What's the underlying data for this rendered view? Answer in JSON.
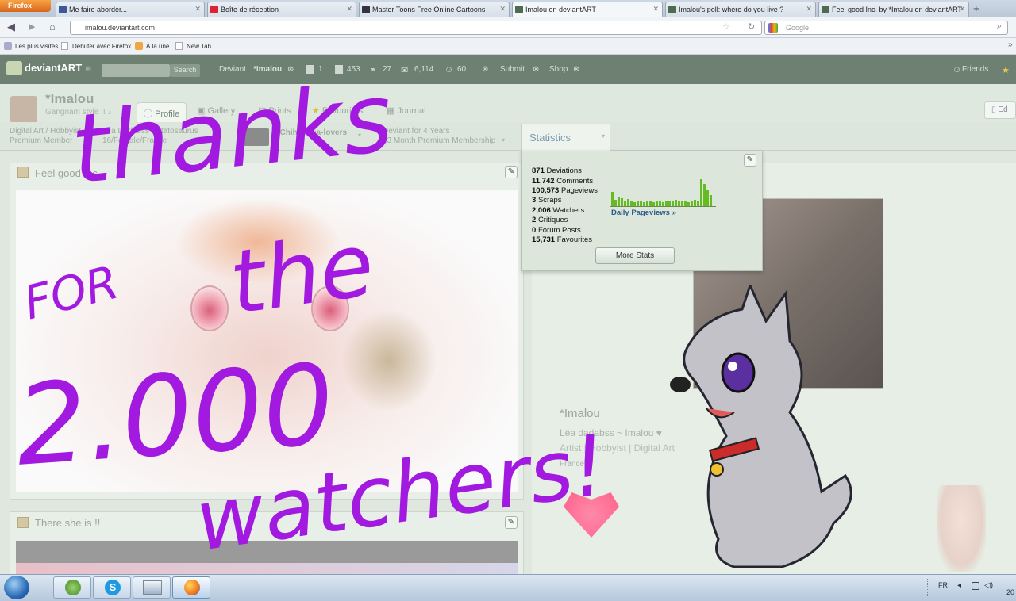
{
  "browser": {
    "app_button": "Firefox",
    "tabs": [
      {
        "label": "Me faire aborder...",
        "color": "#3b5998"
      },
      {
        "label": "Boîte de réception",
        "color": "#d23"
      },
      {
        "label": "Master Toons Free Online Cartoons",
        "color": "#334"
      },
      {
        "label": "Imalou on deviantART",
        "color": "#4e6b52"
      },
      {
        "label": "Imalou's poll: where do you live ?",
        "color": "#4e6b52"
      },
      {
        "label": "Feel good Inc. by *Imalou on deviantART",
        "color": "#4e6b52"
      }
    ],
    "url": "imalou.deviantart.com",
    "search_placeholder": "Google",
    "bookmarks": [
      "Les plus visités",
      "Débuter avec Firefox",
      "À la une",
      "New Tab"
    ]
  },
  "da_nav": {
    "logo": "deviantART",
    "search_btn": "Search",
    "user_label": "Deviant",
    "username": "*Imalou",
    "counts": [
      "1",
      "453",
      "27",
      "6,114",
      "60"
    ],
    "submit": "Submit",
    "shop": "Shop",
    "friends": "Friends",
    "edit": "Ed"
  },
  "profile": {
    "name": "*Imalou",
    "tagline": "Gangnam style !! ♪",
    "tabs": [
      "Profile",
      "Gallery",
      "Prints",
      "Favourites",
      "Journal"
    ],
    "info1_line1": "Digital Art / Hobbyist",
    "info1_line2": "Premium Member",
    "info2_line1": "Léa Dadabss Patatosaurus",
    "info2_line2": "16/Female/France",
    "group": "#Chihuahua-lovers",
    "info4_line1": "Deviant for 4 Years",
    "info4_line2": "13 Month Premium Membership",
    "stats_tab": "Statistics"
  },
  "stats": {
    "lines": [
      {
        "value": "871",
        "label": "Deviations"
      },
      {
        "value": "11,742",
        "label": "Comments"
      },
      {
        "value": "100,573",
        "label": "Pageviews"
      },
      {
        "value": "3",
        "label": "Scraps"
      },
      {
        "value": "2,006",
        "label": "Watchers"
      },
      {
        "value": "2",
        "label": "Critiques"
      },
      {
        "value": "0",
        "label": "Forum Posts"
      },
      {
        "value": "15,731",
        "label": "Favourites"
      }
    ],
    "daily_link": "Daily Pageviews »",
    "more_btn": "More Stats"
  },
  "widgets": {
    "feel_good": "Feel good Inc.",
    "there_she_is": "There she is !!"
  },
  "idcard": {
    "name": "*Imalou",
    "realname": "Léa dadabss ~ Imalou ♥",
    "tags": "Artist | Hobbyist | Digital Art",
    "country": "France"
  },
  "overlay": {
    "line1": "thanks",
    "line2": "FOR",
    "line3": "the",
    "line4": "2.000",
    "line5": "watchers!"
  },
  "taskbar": {
    "lang": "FR",
    "clock": "20"
  }
}
